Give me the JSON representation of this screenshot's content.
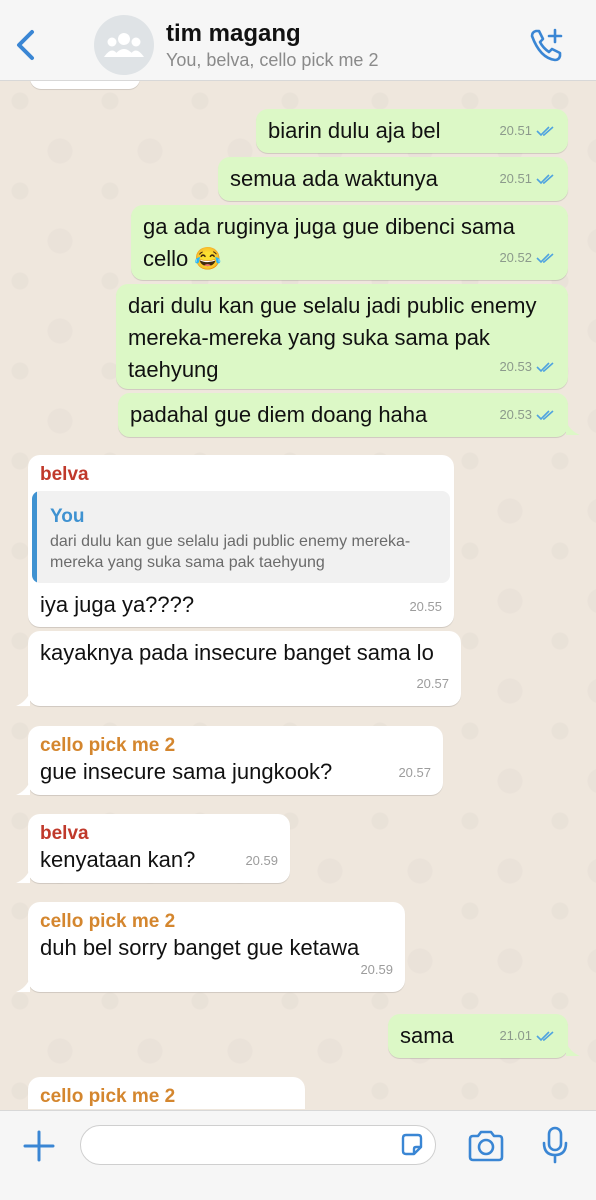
{
  "header": {
    "back_icon": "chevron-left-icon",
    "avatar_icon": "group-icon",
    "title": "tim magang",
    "subtitle": "You, belva, cello pick me 2",
    "call_icon": "add-call-icon"
  },
  "messages": [
    {
      "dir": "out",
      "text": "biarin dulu aja bel",
      "time": "20.51"
    },
    {
      "dir": "out",
      "text": "semua ada waktunya",
      "time": "20.51"
    },
    {
      "dir": "out",
      "text": "ga ada ruginya juga gue dibenci sama cello 😂",
      "time": "20.52"
    },
    {
      "dir": "out",
      "text": "dari dulu kan gue selalu jadi public enemy mereka-mereka yang suka sama pak taehyung",
      "time": "20.53"
    },
    {
      "dir": "out",
      "text": "padahal gue diem doang haha",
      "time": "20.53"
    },
    {
      "dir": "in",
      "sender": "belva",
      "quote_name": "You",
      "quote_text": "dari dulu kan gue selalu jadi public enemy mereka-mereka yang suka sama pak taehyung",
      "text": "iya juga ya????",
      "time": "20.55"
    },
    {
      "dir": "in",
      "text": "kayaknya pada insecure banget sama lo",
      "time": "20.57"
    },
    {
      "dir": "in",
      "sender": "cello pick me 2",
      "text": "gue insecure sama jungkook?",
      "time": "20.57"
    },
    {
      "dir": "in",
      "sender": "belva",
      "text": "kenyataan kan?",
      "time": "20.59"
    },
    {
      "dir": "in",
      "sender": "cello pick me 2",
      "text": "duh bel sorry banget gue ketawa",
      "time": "20.59"
    },
    {
      "dir": "out",
      "text": "sama",
      "time": "21.01"
    },
    {
      "dir": "in",
      "sender": "cello pick me 2",
      "text": "",
      "time": ""
    }
  ],
  "colors": {
    "belva": "#c0392b",
    "cello": "#d4862e",
    "accent": "#3f92d1",
    "out_bubble": "#dcf8c6",
    "read_ticks": "#4fa3e0"
  },
  "footer": {
    "plus_icon": "plus-icon",
    "input_placeholder": "",
    "sticker_icon": "sticker-icon",
    "camera_icon": "camera-icon",
    "mic_icon": "microphone-icon"
  }
}
